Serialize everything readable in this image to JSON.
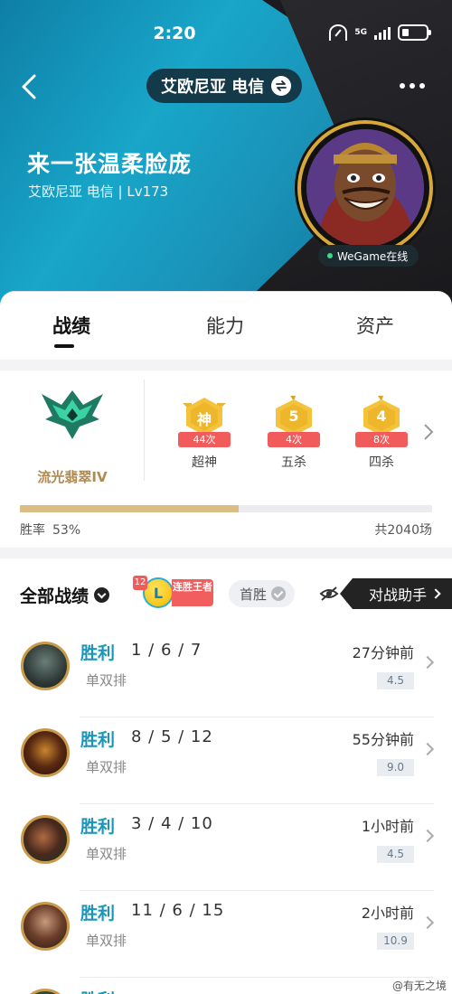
{
  "status_bar": {
    "time": "2:20",
    "network": "5G"
  },
  "header": {
    "server": "艾欧尼亚 电信",
    "player_name": "来一张温柔脸庞",
    "player_sub": "艾欧尼亚 电信 | Lv173",
    "online_status": "WeGame在线"
  },
  "tabs": [
    {
      "label": "战绩",
      "active": true
    },
    {
      "label": "能力",
      "active": false
    },
    {
      "label": "资产",
      "active": false
    }
  ],
  "rank": {
    "label": "流光翡翠IV",
    "color": "#2fa884"
  },
  "achievements": [
    {
      "glyph": "神",
      "count": "44次",
      "label": "超神"
    },
    {
      "glyph": "5",
      "count": "4次",
      "label": "五杀"
    },
    {
      "glyph": "4",
      "count": "8次",
      "label": "四杀"
    }
  ],
  "stats": {
    "winrate_label": "胜率",
    "winrate": "53%",
    "winrate_fraction": 0.53,
    "total": "共2040场"
  },
  "filter": {
    "all_records": "全部战绩",
    "streak_count": "12",
    "streak_letter": "L",
    "streak_text": "连胜王者",
    "first_win": "首胜",
    "assist": "对战助手"
  },
  "matches": [
    {
      "result": "胜利",
      "kda": "1 / 6 / 7",
      "queue": "单双排",
      "time": "27分钟前",
      "score": "4.5"
    },
    {
      "result": "胜利",
      "kda": "8 / 5 / 12",
      "queue": "单双排",
      "time": "55分钟前",
      "score": "9.0"
    },
    {
      "result": "胜利",
      "kda": "3 / 4 / 10",
      "queue": "单双排",
      "time": "1小时前",
      "score": "4.5"
    },
    {
      "result": "胜利",
      "kda": "11 / 6 / 15",
      "queue": "单双排",
      "time": "2小时前",
      "score": "10.9"
    },
    {
      "result": "胜利",
      "kda": "",
      "queue": "",
      "time": "",
      "score": ""
    }
  ],
  "watermark": "@有无之境",
  "colors": {
    "accent_blue": "#1996ba",
    "gold": "#d9bd82",
    "badge_red": "#f15b5b",
    "achievement_gold": "#f5c33b"
  }
}
